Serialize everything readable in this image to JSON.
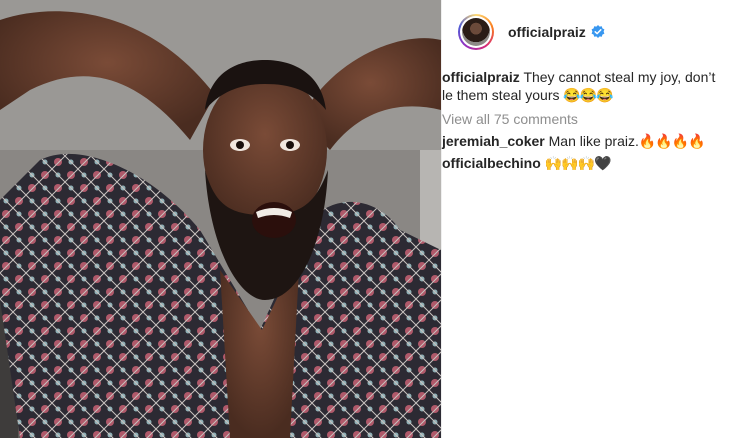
{
  "post": {
    "username": "officialpraiz",
    "verified": true,
    "caption_user": "officialpraiz",
    "caption_text": "They cannot steal my joy, don’t le them steal yours",
    "caption_emoji": "😂😂😂",
    "view_all": "View all 75 comments"
  },
  "comments": [
    {
      "user": "jeremiah_coker",
      "text": "Man like praiz.",
      "emoji": "🔥🔥🔥🔥"
    },
    {
      "user": "officialbechino",
      "text": "",
      "emoji": "🙌🙌🙌🖤"
    }
  ],
  "colors": {
    "verified_blue": "#3897f0",
    "muted": "#8e8e8e"
  }
}
